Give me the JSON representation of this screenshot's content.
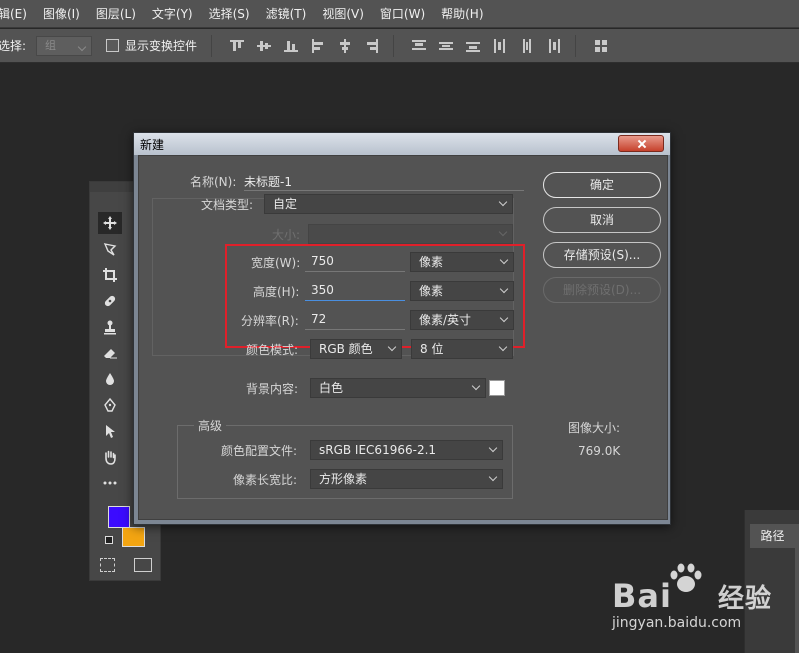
{
  "menu": [
    "辑(E)",
    "图像(I)",
    "图层(L)",
    "文字(Y)",
    "选择(S)",
    "滤镜(T)",
    "视图(V)",
    "窗口(W)",
    "帮助(H)"
  ],
  "options_bar": {
    "select_label": "选择:",
    "select_value": "组",
    "show_transform_label": "显示变换控件"
  },
  "dialog": {
    "title": "新建",
    "name_label": "名称(N):",
    "name_value": "未标题-1",
    "doc_type_label": "文档类型:",
    "doc_type_value": "自定",
    "size_label": "大小:",
    "width_label": "宽度(W):",
    "width_value": "750",
    "width_unit": "像素",
    "height_label": "高度(H):",
    "height_value": "350",
    "height_unit": "像素",
    "resolution_label": "分辨率(R):",
    "resolution_value": "72",
    "resolution_unit": "像素/英寸",
    "color_mode_label": "颜色模式:",
    "color_mode_value": "RGB 颜色",
    "bit_depth_value": "8 位",
    "background_label": "背景内容:",
    "background_value": "白色",
    "advanced_label": "高级",
    "color_profile_label": "颜色配置文件:",
    "color_profile_value": "sRGB IEC61966-2.1",
    "pixel_aspect_label": "像素长宽比:",
    "pixel_aspect_value": "方形像素",
    "image_size_label": "图像大小:",
    "image_size_value": "769.0K",
    "buttons": {
      "ok": "确定",
      "cancel": "取消",
      "save_preset": "存储预设(S)...",
      "delete_preset": "删除预设(D)..."
    }
  },
  "panels": {
    "paths_tab": "路径"
  },
  "colors": {
    "foreground": "#3b0bff",
    "background": "#f3a512",
    "highlight": "#e0202a"
  },
  "watermark": {
    "brand": "Bai",
    "product": "经验",
    "url": "jingyan.baidu.com"
  }
}
